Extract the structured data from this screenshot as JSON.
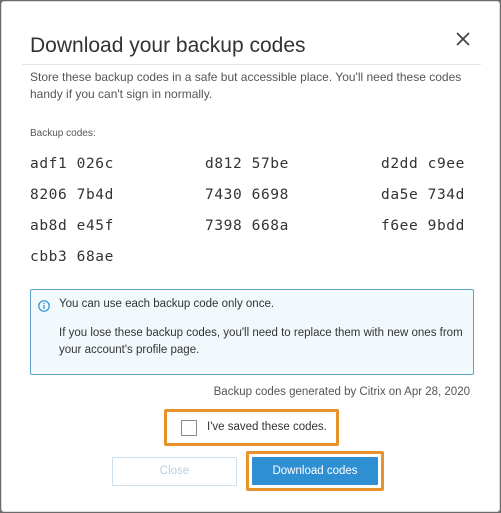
{
  "dialog": {
    "title": "Download your backup codes",
    "intro": "Store these backup codes in a safe but accessible place. You'll need these codes handy if you can't sign in normally.",
    "codes_label": "Backup codes:",
    "codes": [
      [
        "adf1 026c",
        "d812 57be",
        "d2dd c9ee"
      ],
      [
        "8206 7b4d",
        "7430 6698",
        "da5e 734d"
      ],
      [
        "ab8d e45f",
        "7398 668a",
        "f6ee 9bdd"
      ],
      [
        "cbb3 68ae"
      ]
    ],
    "info": {
      "icon": "info-icon",
      "line1": "You can use each backup code only once.",
      "line2": "If you lose these backup codes, you'll need to replace them with new ones from your account's profile page."
    },
    "generated_text": "Backup codes generated by Citrix on Apr 28, 2020",
    "confirm_label": "I've saved these codes.",
    "confirm_checked": false,
    "close_button": "Close",
    "download_button": "Download codes",
    "close_icon": "close-icon"
  },
  "colors": {
    "accent": "#2e8fd3",
    "highlight": "#e8922a",
    "info_border": "#5fa3c9",
    "info_bg": "#f2f9fd"
  }
}
